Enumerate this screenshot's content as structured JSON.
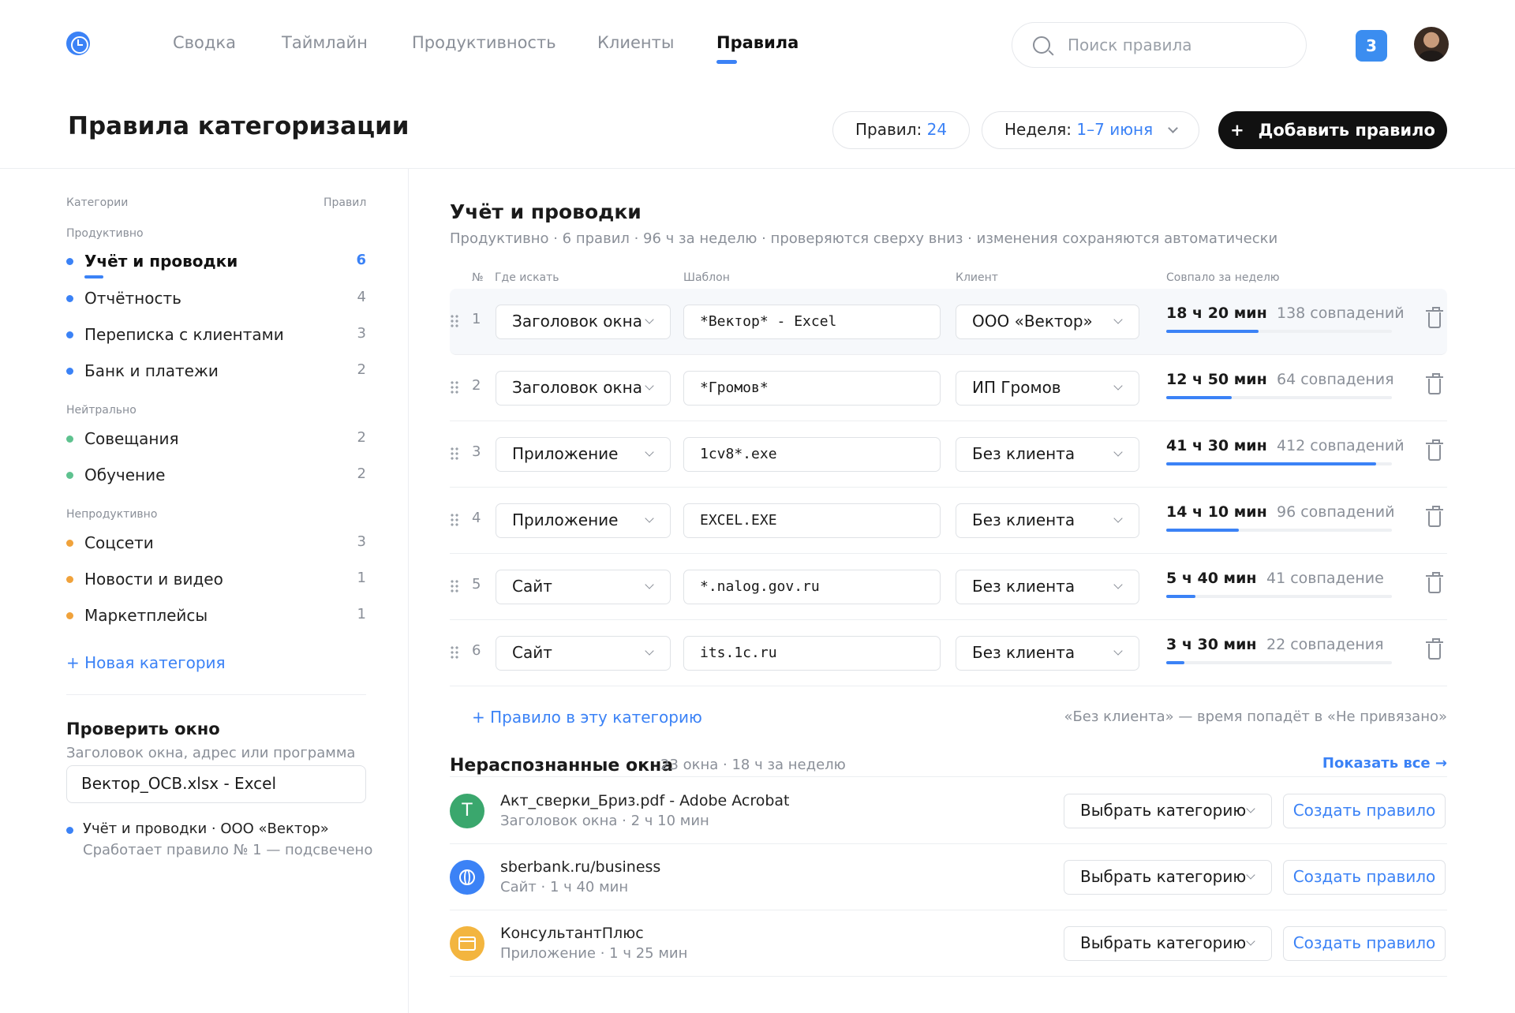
{
  "nav": {
    "items": [
      "Сводка",
      "Таймлайн",
      "Продуктивность",
      "Клиенты",
      "Правила"
    ],
    "active": "Правила",
    "search_placeholder": "Поиск правила",
    "notifications": "3"
  },
  "header": {
    "title": "Правила категоризации",
    "rules_label": "Правил:",
    "rules_count": "24",
    "week_label": "Неделя:",
    "week_value": "1–7 июня",
    "add_button": "Добавить правило",
    "add_icon": "+"
  },
  "sidebar": {
    "col_categories": "Категории",
    "col_rules": "Правил",
    "groups": [
      {
        "name": "Продуктивно",
        "color": "#3b82f6",
        "items": [
          {
            "label": "Учёт и проводки",
            "count": "6",
            "active": true
          },
          {
            "label": "Отчётность",
            "count": "4"
          },
          {
            "label": "Переписка с клиентами",
            "count": "3"
          },
          {
            "label": "Банк и платежи",
            "count": "2"
          }
        ]
      },
      {
        "name": "Нейтрально",
        "color": "#5ec28f",
        "items": [
          {
            "label": "Совещания",
            "count": "2"
          },
          {
            "label": "Обучение",
            "count": "2"
          }
        ]
      },
      {
        "name": "Непродуктивно",
        "color": "#f0a23b",
        "items": [
          {
            "label": "Соцсети",
            "count": "3"
          },
          {
            "label": "Новости и видео",
            "count": "1"
          },
          {
            "label": "Маркетплейсы",
            "count": "1"
          }
        ]
      }
    ],
    "new_category": "+ Новая категория",
    "check": {
      "title": "Проверить окно",
      "subtitle": "Заголовок окна, адрес или программа",
      "value": "Вектор_ОСВ.xlsx - Excel",
      "result_title": "Учёт и проводки · ООО «Вектор»",
      "result_sub": "Сработает правило № 1 — подсвечено"
    }
  },
  "main": {
    "title": "Учёт и проводки",
    "subtitle": "Продуктивно · 6 правил · 96 ч за неделю · проверяются сверху вниз · изменения сохраняются автоматически",
    "columns": {
      "num": "№",
      "where": "Где искать",
      "pattern": "Шаблон",
      "client": "Клиент",
      "matched": "Совпало за неделю"
    },
    "rules": [
      {
        "num": "1",
        "where": "Заголовок окна",
        "pattern": "*Вектор* - Excel",
        "client": "ООО «Вектор»",
        "time": "18 ч 20 мин",
        "matches": "138 совпадений",
        "share": 0.41
      },
      {
        "num": "2",
        "where": "Заголовок окна",
        "pattern": "*Громов*",
        "client": "ИП Громов",
        "time": "12 ч 50 мин",
        "matches": "64 совпадения",
        "share": 0.29
      },
      {
        "num": "3",
        "where": "Приложение",
        "pattern": "1cv8*.exe",
        "client": "Без клиента",
        "time": "41 ч 30 мин",
        "matches": "412 совпадений",
        "share": 0.93
      },
      {
        "num": "4",
        "where": "Приложение",
        "pattern": "EXCEL.EXE",
        "client": "Без клиента",
        "time": "14 ч 10 мин",
        "matches": "96 совпадений",
        "share": 0.32
      },
      {
        "num": "5",
        "where": "Сайт",
        "pattern": "*.nalog.gov.ru",
        "client": "Без клиента",
        "time": "5 ч 40 мин",
        "matches": "41 совпадение",
        "share": 0.13
      },
      {
        "num": "6",
        "where": "Сайт",
        "pattern": "its.1c.ru",
        "client": "Без клиента",
        "time": "3 ч 30 мин",
        "matches": "22 совпадения",
        "share": 0.08
      }
    ],
    "add_rule": "+ Правило в эту категорию",
    "note": "«Без клиента» — время попадёт в «Не привязано»"
  },
  "unrecognized": {
    "title": "Нераспознанные окна",
    "subtitle": "23 окна · 18 ч за неделю",
    "show_all": "Показать все →",
    "select_label": "Выбрать категорию",
    "create_label": "Создать правило",
    "items": [
      {
        "icon": "T",
        "icon_type": "document-icon",
        "name": "Акт_сверки_Бриз.pdf - Adobe Acrobat",
        "meta": "Заголовок окна · 2 ч 10 мин"
      },
      {
        "icon": "",
        "icon_type": "globe-icon",
        "name": "sberbank.ru/business",
        "meta": "Сайт · 1 ч 40 мин"
      },
      {
        "icon": "",
        "icon_type": "window-icon",
        "name": "КонсультантПлюс",
        "meta": "Приложение · 1 ч 25 мин"
      }
    ]
  }
}
